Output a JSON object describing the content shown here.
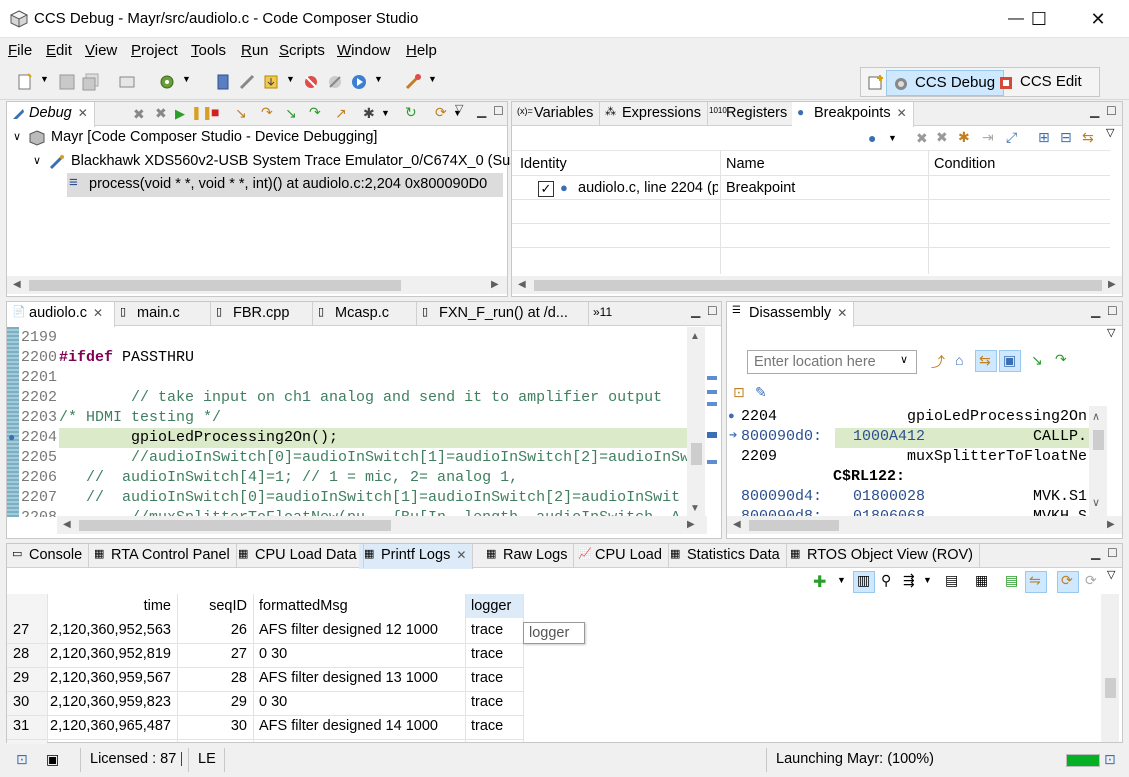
{
  "window": {
    "title": "CCS Debug - Mayr/src/audiolo.c - Code Composer Studio",
    "minimize": "—",
    "maximize": "☐",
    "close": "✕"
  },
  "menu": {
    "items": [
      {
        "u": "F",
        "rest": "ile"
      },
      {
        "u": "E",
        "rest": "dit"
      },
      {
        "u": "V",
        "rest": "iew"
      },
      {
        "u": "P",
        "rest": "roject"
      },
      {
        "u": "T",
        "rest": "ools"
      },
      {
        "u": "R",
        "rest": "un"
      },
      {
        "u": "S",
        "rest": "cripts"
      },
      {
        "u": "W",
        "rest": "indow"
      },
      {
        "u": "H",
        "rest": "elp"
      }
    ]
  },
  "perspectives": {
    "debug": "CCS Debug",
    "edit": "CCS Edit"
  },
  "debug_view": {
    "tab": "Debug",
    "tree": [
      "Mayr [Code Composer Studio - Device Debugging]",
      "Blackhawk XDS560v2-USB System Trace Emulator_0/C674X_0 (Sus",
      "process(void * *, void * *, int)() at audiolo.c:2,204 0x800090D0"
    ]
  },
  "top_right": {
    "tabs": [
      "Variables",
      "Expressions",
      "Registers",
      "Breakpoints"
    ],
    "columns": [
      "Identity",
      "Name",
      "Condition"
    ],
    "row": {
      "identity": "audiolo.c, line 2204 (p",
      "name": "Breakpoint",
      "condition": ""
    }
  },
  "editor": {
    "tabs": [
      "audiolo.c",
      "main.c",
      "FBR.cpp",
      "Mcasp.c",
      "FXN_F_run() at /d...",
      "»11"
    ],
    "lines": [
      {
        "n": "2199",
        "parts": []
      },
      {
        "n": "2200",
        "parts": [
          {
            "k": "kw",
            "t": "#ifdef"
          },
          {
            "k": "",
            "t": " PASSTHRU"
          }
        ]
      },
      {
        "n": "2201",
        "parts": []
      },
      {
        "n": "2202",
        "parts": [
          {
            "k": "cm",
            "t": "        // take input on ch1 analog and send it to amplifier output"
          }
        ]
      },
      {
        "n": "2203",
        "parts": [
          {
            "k": "cm",
            "t": "/* HDMI testing */"
          }
        ]
      },
      {
        "n": "2204",
        "parts": [
          {
            "k": "",
            "t": "        gpioLedProcessing2On();"
          }
        ]
      },
      {
        "n": "2205",
        "parts": [
          {
            "k": "cm",
            "t": "        //audioInSwitch[0]=audioInSwitch[1]=audioInSwitch[2]=audioInSw"
          }
        ]
      },
      {
        "n": "2206",
        "parts": [
          {
            "k": "cm",
            "t": "   //  audioInSwitch[4]=1; // 1 = mic, 2= analog 1,"
          }
        ]
      },
      {
        "n": "2207",
        "parts": [
          {
            "k": "cm",
            "t": "   //  audioInSwitch[0]=audioInSwitch[1]=audioInSwitch[2]=audioInSwit"
          }
        ]
      },
      {
        "n": "2208",
        "parts": [
          {
            "k": "cm",
            "t": "        //muxSplitterToFloatNew(pu   {Bu[In  length  audioInSwitch  A"
          }
        ]
      }
    ]
  },
  "disassembly": {
    "tab": "Disassembly",
    "location_placeholder": "Enter location here",
    "rows": [
      {
        "addr": "2204",
        "code": "",
        "text": "gpioLedProcessing2On"
      },
      {
        "addr": "800090d0:",
        "code": "1000A412",
        "text": "CALLP."
      },
      {
        "addr": "2209",
        "code": "",
        "text": "muxSplitterToFloatNe"
      },
      {
        "addr": "C$RL122:",
        "code": "",
        "text": ""
      },
      {
        "addr": "800090d4:",
        "code": "01800028",
        "text": "MVK.S1"
      },
      {
        "addr": "800090d8:",
        "code": "01806068",
        "text": "MVKH.S"
      }
    ]
  },
  "bottom": {
    "tabs": [
      "Console",
      "RTA Control Panel",
      "CPU Load Data",
      "Printf Logs",
      "Raw Logs",
      "CPU Load",
      "Statistics Data",
      "RTOS Object View (ROV)"
    ],
    "columns": [
      "",
      "time",
      "seqID",
      "formattedMsg",
      "logger"
    ],
    "rows": [
      {
        "idx": "27",
        "time": "2,120,360,952,563",
        "seq": "26",
        "msg": "AFS filter designed 12 1000",
        "logger": "trace"
      },
      {
        "idx": "28",
        "time": "2,120,360,952,819",
        "seq": "27",
        "msg": "0 30",
        "logger": "trace"
      },
      {
        "idx": "29",
        "time": "2,120,360,959,567",
        "seq": "28",
        "msg": "AFS filter designed 13 1000",
        "logger": "trace"
      },
      {
        "idx": "30",
        "time": "2,120,360,959,823",
        "seq": "29",
        "msg": "0 30",
        "logger": "trace"
      },
      {
        "idx": "31",
        "time": "2,120,360,965,487",
        "seq": "30",
        "msg": "AFS filter designed 14 1000",
        "logger": "trace"
      }
    ],
    "tooltip": "logger"
  },
  "statusbar": {
    "licensed": "Licensed : 87 [",
    "mode": "LE",
    "launching": "Launching Mayr: (100%)",
    "progress": 1.0
  },
  "colors": {
    "highlight_line": "#dbeac8",
    "selection": "#dcdcdc",
    "accent": "#cde8ff",
    "progress": "#06b025"
  }
}
